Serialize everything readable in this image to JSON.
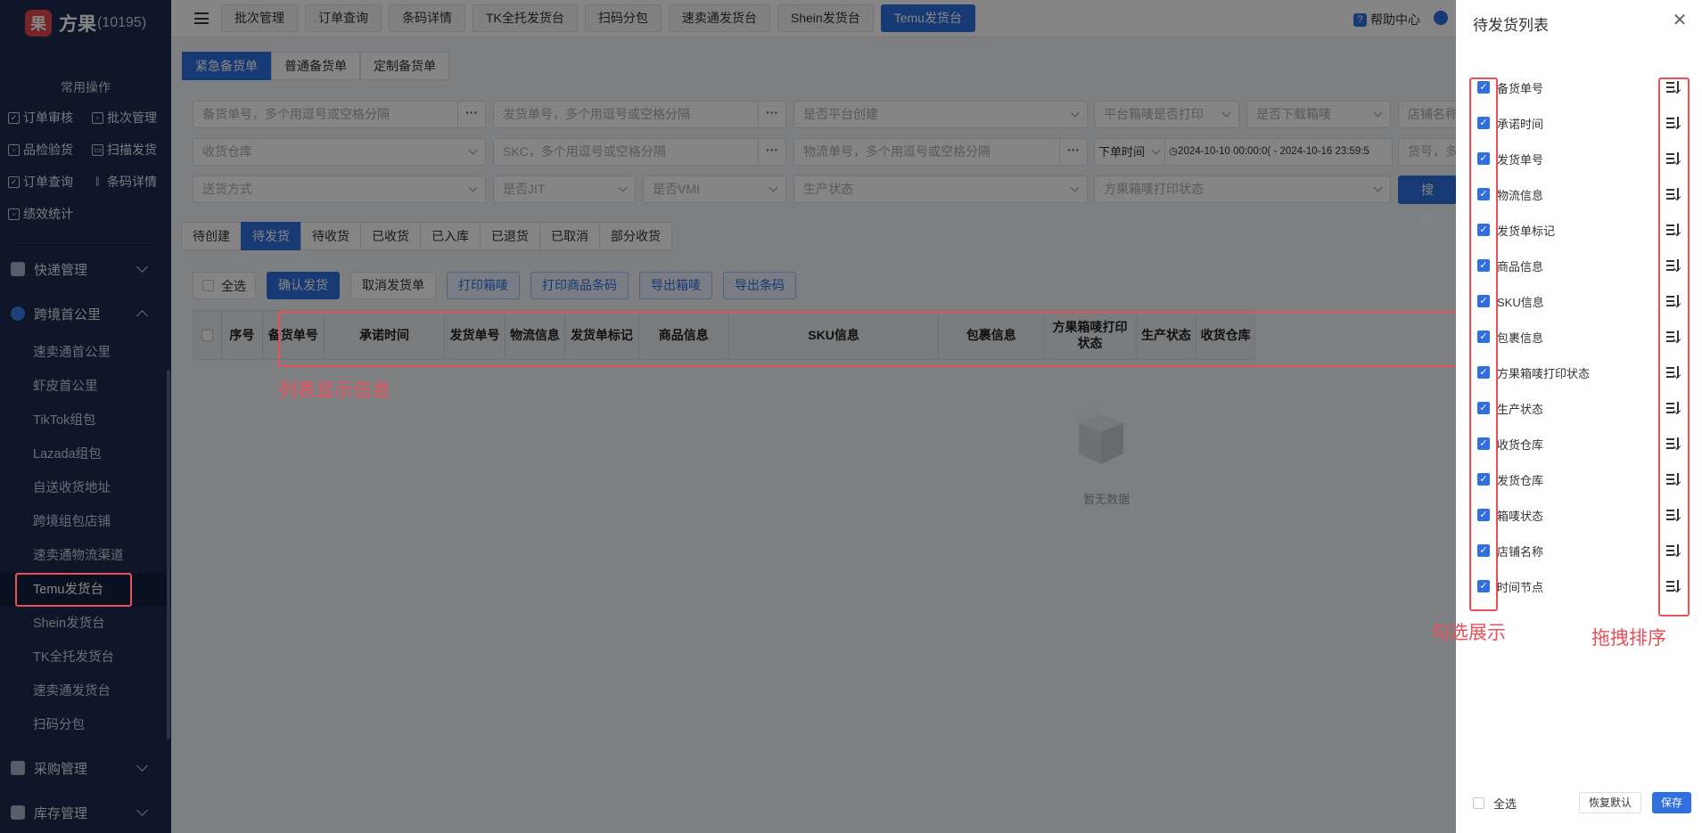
{
  "app": {
    "logo_glyph": "果",
    "name": "方果",
    "id_text": "(10195)"
  },
  "sidebar": {
    "common_title": "常用操作",
    "quick_actions": [
      "订单审核",
      "批次管理",
      "品检验货",
      "扫描发货",
      "订单查询",
      "条码详情",
      "绩效统计"
    ],
    "groups": {
      "express": "快递管理",
      "cross": "跨境首公里",
      "purchase": "采购管理",
      "stock": "库存管理"
    },
    "sub_items": [
      "速卖通首公里",
      "虾皮首公里",
      "TikTok组包",
      "Lazada组包",
      "自送收货地址",
      "跨境组包店铺",
      "速卖通物流渠道",
      "Temu发货台",
      "Shein发货台",
      "TK全托发货台",
      "速卖通发货台",
      "扫码分包"
    ]
  },
  "topbar": {
    "tabs": [
      "批次管理",
      "订单查询",
      "条码详情",
      "TK全托发货台",
      "扫码分包",
      "速卖通发货台",
      "Shein发货台",
      "Temu发货台"
    ],
    "help": "帮助中心"
  },
  "sub_tabs": [
    "紧急备货单",
    "普通备货单",
    "定制备货单"
  ],
  "filters": {
    "r1": [
      "备货单号，多个用逗号或空格分隔",
      "发货单号，多个用逗号或空格分隔",
      "是否平台创建",
      "平台箱唛是否打印",
      "是否下载箱唛",
      "店铺名称"
    ],
    "r2": [
      "收货仓库",
      "SKC，多个用逗号或空格分隔",
      "物流单号，多个用逗号或空格分隔",
      "下单时间",
      "2024-10-10 00:00:0( - 2024-10-16 23:59:5",
      "货号，多个"
    ],
    "r3": [
      "送货方式",
      "是否JIT",
      "是否VMI",
      "生产状态",
      "方果箱唛打印状态"
    ],
    "search": "搜索"
  },
  "status_tabs": [
    "待创建",
    "待发货",
    "待收货",
    "已收货",
    "已入库",
    "已退货",
    "已取消",
    "部分收货"
  ],
  "actions": {
    "select_all": "全选",
    "buttons": [
      "确认发货",
      "取消发货单",
      "打印箱唛",
      "打印商品条码",
      "导出箱唛",
      "导出条码"
    ]
  },
  "table": {
    "headers": [
      "序号",
      "备货单号",
      "承诺时间",
      "发货单号",
      "物流信息",
      "发货单标记",
      "商品信息",
      "SKU信息",
      "包裹信息",
      "方果箱唛打印状态",
      "生产状态",
      "收货仓库"
    ],
    "empty": "暂无数据"
  },
  "annotations": {
    "list_info": "列表显示信息",
    "check_show": "勾选展示",
    "drag_sort": "拖拽排序"
  },
  "drawer": {
    "title": "待发货列表",
    "columns": [
      "备货单号",
      "承诺时间",
      "发货单号",
      "物流信息",
      "发货单标记",
      "商品信息",
      "SKU信息",
      "包裹信息",
      "方果箱唛打印状态",
      "生产状态",
      "收货仓库",
      "发货仓库",
      "箱唛状态",
      "店铺名称",
      "时间节点"
    ],
    "select_all": "全选",
    "reset": "恢复默认",
    "save": "保存"
  },
  "colors": {
    "primary": "#2f6fde",
    "sidebar_bg": "#1d2b4f",
    "annotation": "#e8505b"
  }
}
